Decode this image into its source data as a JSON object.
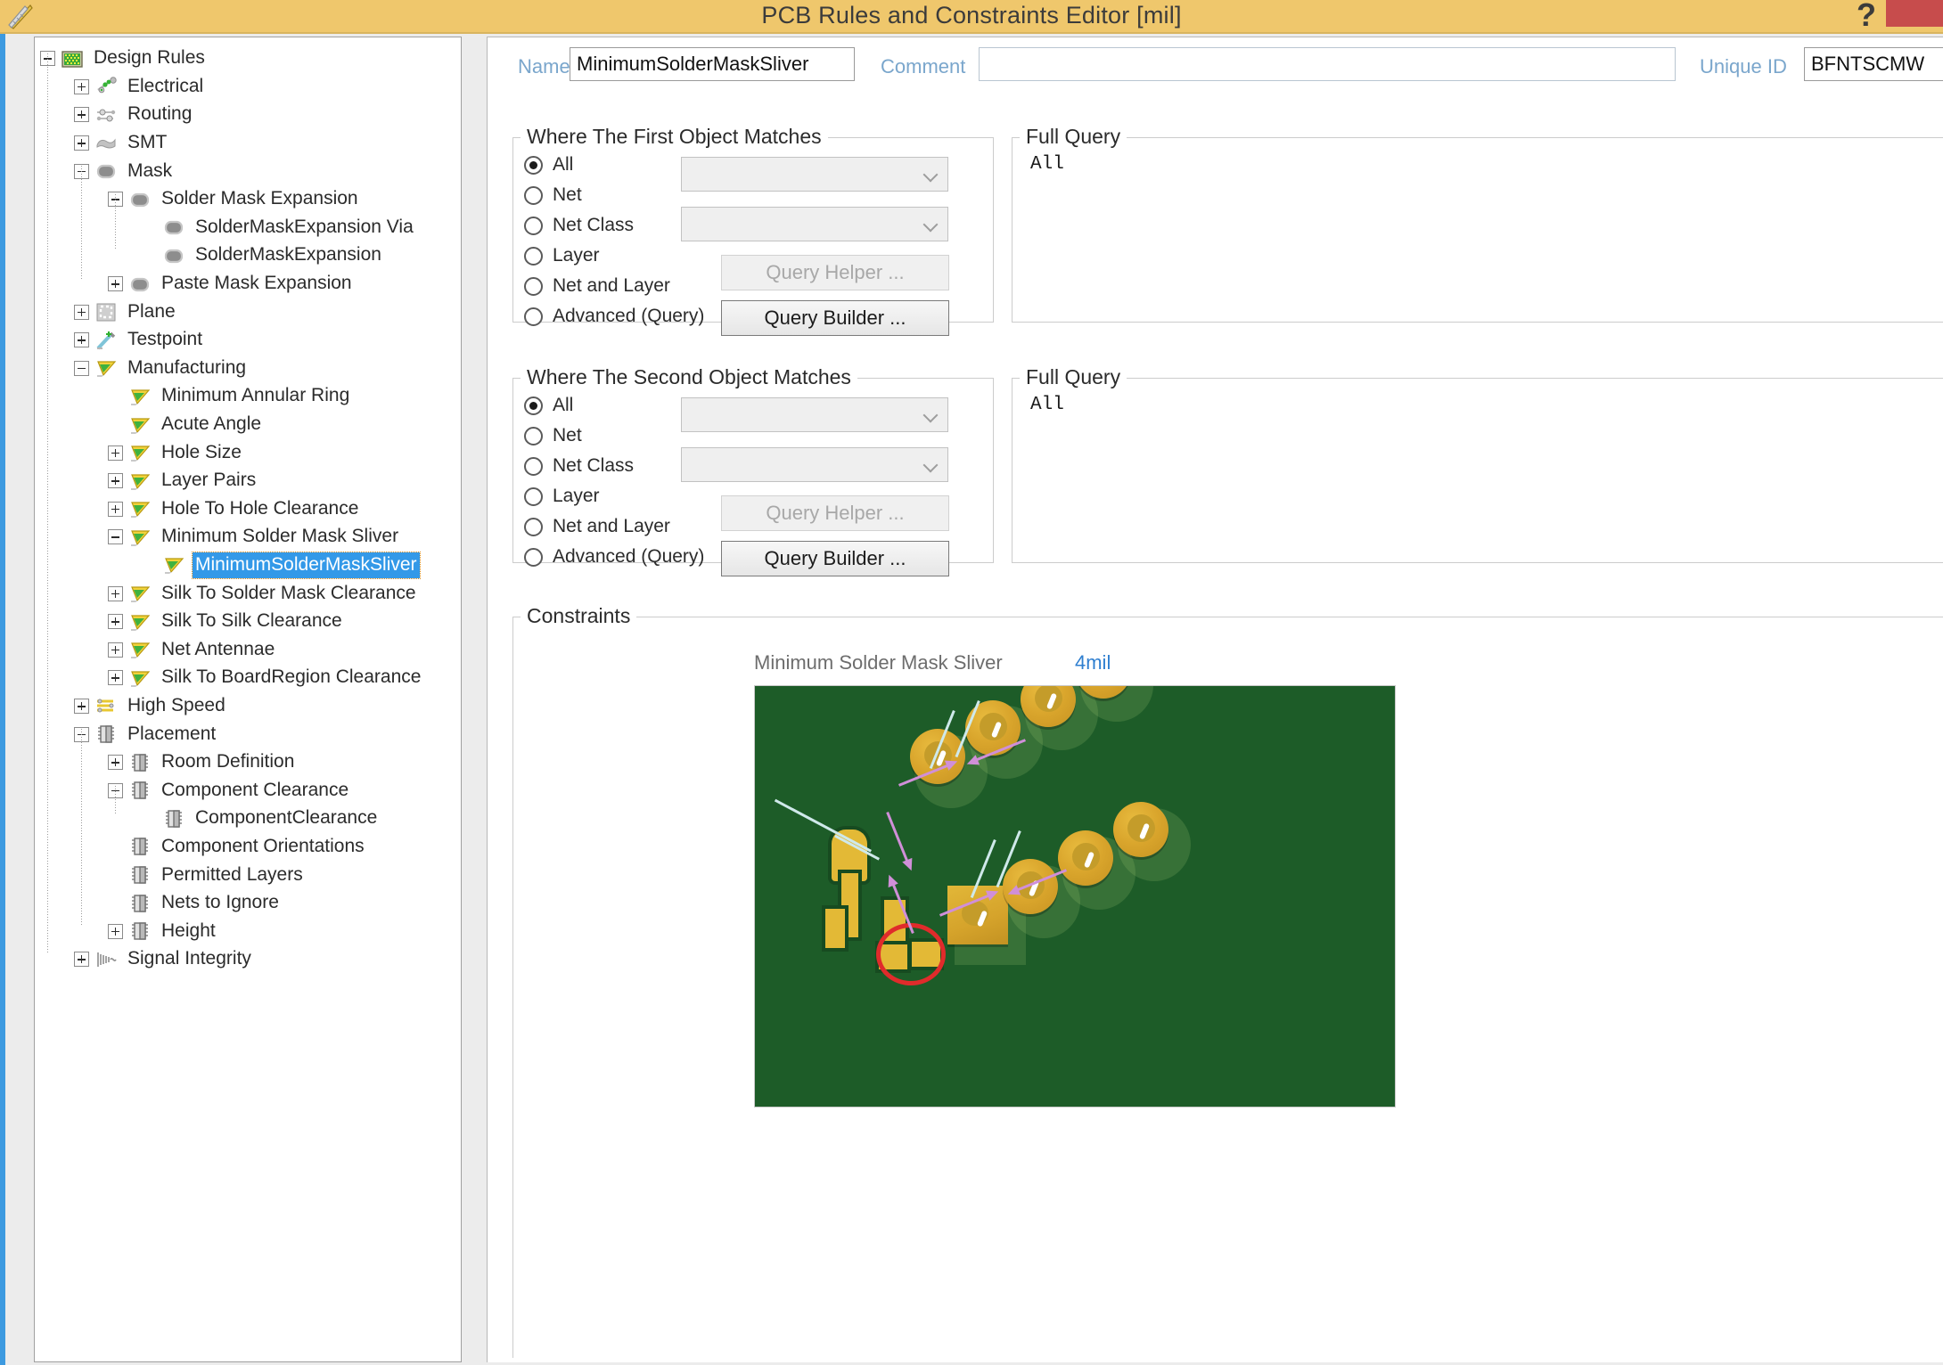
{
  "window": {
    "title": "PCB Rules and Constraints Editor [mil]",
    "help_label": "?",
    "app_icon": "ruler-triangle-icon",
    "close_label": "",
    "titlebar_color": "#efc76c",
    "accent_color": "#3d9ae0"
  },
  "tree": {
    "nodes": [
      {
        "label": "Design Rules",
        "depth": 0,
        "state": "minus",
        "icon": "design-rules-folder-icon",
        "selected": false
      },
      {
        "label": "Electrical",
        "depth": 1,
        "state": "plus",
        "icon": "electrical-icon",
        "selected": false
      },
      {
        "label": "Routing",
        "depth": 1,
        "state": "plus",
        "icon": "routing-icon",
        "selected": false
      },
      {
        "label": "SMT",
        "depth": 1,
        "state": "plus",
        "icon": "smt-icon",
        "selected": false
      },
      {
        "label": "Mask",
        "depth": 1,
        "state": "minus",
        "icon": "mask-icon",
        "selected": false
      },
      {
        "label": "Solder Mask Expansion",
        "depth": 2,
        "state": "minus",
        "icon": "mask-icon",
        "selected": false
      },
      {
        "label": "SolderMaskExpansion Via",
        "depth": 3,
        "state": "leaf",
        "icon": "mask-icon",
        "selected": false
      },
      {
        "label": "SolderMaskExpansion",
        "depth": 3,
        "state": "leaf",
        "icon": "mask-icon",
        "selected": false
      },
      {
        "label": "Paste Mask Expansion",
        "depth": 2,
        "state": "plus",
        "icon": "mask-icon",
        "selected": false
      },
      {
        "label": "Plane",
        "depth": 1,
        "state": "plus",
        "icon": "plane-icon",
        "selected": false
      },
      {
        "label": "Testpoint",
        "depth": 1,
        "state": "plus",
        "icon": "testpoint-icon",
        "selected": false
      },
      {
        "label": "Manufacturing",
        "depth": 1,
        "state": "minus",
        "icon": "manufacturing-icon",
        "selected": false
      },
      {
        "label": "Minimum Annular Ring",
        "depth": 2,
        "state": "leaf",
        "icon": "manufacturing-icon",
        "selected": false
      },
      {
        "label": "Acute Angle",
        "depth": 2,
        "state": "leaf",
        "icon": "manufacturing-icon",
        "selected": false
      },
      {
        "label": "Hole Size",
        "depth": 2,
        "state": "plus",
        "icon": "manufacturing-icon",
        "selected": false
      },
      {
        "label": "Layer Pairs",
        "depth": 2,
        "state": "plus",
        "icon": "manufacturing-icon",
        "selected": false
      },
      {
        "label": "Hole To Hole Clearance",
        "depth": 2,
        "state": "plus",
        "icon": "manufacturing-icon",
        "selected": false
      },
      {
        "label": "Minimum Solder Mask Sliver",
        "depth": 2,
        "state": "minus",
        "icon": "manufacturing-icon",
        "selected": false
      },
      {
        "label": "MinimumSolderMaskSliver",
        "depth": 3,
        "state": "leaf",
        "icon": "manufacturing-icon",
        "selected": true
      },
      {
        "label": "Silk To Solder Mask Clearance",
        "depth": 2,
        "state": "plus",
        "icon": "manufacturing-icon",
        "selected": false
      },
      {
        "label": "Silk To Silk Clearance",
        "depth": 2,
        "state": "plus",
        "icon": "manufacturing-icon",
        "selected": false
      },
      {
        "label": "Net Antennae",
        "depth": 2,
        "state": "plus",
        "icon": "manufacturing-icon",
        "selected": false
      },
      {
        "label": "Silk To BoardRegion Clearance",
        "depth": 2,
        "state": "plus",
        "icon": "manufacturing-icon",
        "selected": false
      },
      {
        "label": "High Speed",
        "depth": 1,
        "state": "plus",
        "icon": "high-speed-icon",
        "selected": false
      },
      {
        "label": "Placement",
        "depth": 1,
        "state": "minus",
        "icon": "placement-icon",
        "selected": false
      },
      {
        "label": "Room Definition",
        "depth": 2,
        "state": "plus",
        "icon": "placement-icon",
        "selected": false
      },
      {
        "label": "Component Clearance",
        "depth": 2,
        "state": "minus",
        "icon": "placement-icon",
        "selected": false
      },
      {
        "label": "ComponentClearance",
        "depth": 3,
        "state": "leaf",
        "icon": "placement-icon",
        "selected": false
      },
      {
        "label": "Component Orientations",
        "depth": 2,
        "state": "leaf",
        "icon": "placement-icon",
        "selected": false
      },
      {
        "label": "Permitted Layers",
        "depth": 2,
        "state": "leaf",
        "icon": "placement-icon",
        "selected": false
      },
      {
        "label": "Nets to Ignore",
        "depth": 2,
        "state": "leaf",
        "icon": "placement-icon",
        "selected": false
      },
      {
        "label": "Height",
        "depth": 2,
        "state": "plus",
        "icon": "placement-icon",
        "selected": false
      },
      {
        "label": "Signal Integrity",
        "depth": 1,
        "state": "plus",
        "icon": "signal-integrity-icon",
        "selected": false
      }
    ]
  },
  "header": {
    "name_label": "Name",
    "name_value": "MinimumSolderMaskSliver",
    "comment_label": "Comment",
    "comment_value": "",
    "comment_placeholder": "",
    "unique_id_label": "Unique ID",
    "unique_id_value": "BFNTSCMW"
  },
  "first_object": {
    "title": "Where The First Object Matches",
    "options": [
      "All",
      "Net",
      "Net Class",
      "Layer",
      "Net and Layer",
      "Advanced (Query)"
    ],
    "selected": "All",
    "net_combo_value": "",
    "netclass_combo_value": "",
    "query_helper_label": "Query Helper ...",
    "query_builder_label": "Query Builder ...",
    "full_query_title": "Full Query",
    "full_query_text": "All"
  },
  "second_object": {
    "title": "Where The Second Object Matches",
    "options": [
      "All",
      "Net",
      "Net Class",
      "Layer",
      "Net and Layer",
      "Advanced (Query)"
    ],
    "selected": "All",
    "net_combo_value": "",
    "netclass_combo_value": "",
    "query_helper_label": "Query Helper ...",
    "query_builder_label": "Query Builder ...",
    "full_query_title": "Full Query",
    "full_query_text": "All"
  },
  "constraints": {
    "title": "Constraints",
    "rule_label": "Minimum Solder Mask Sliver",
    "rule_value": "4mil",
    "value_color": "#2f7fd0",
    "figure": {
      "name": "pcb-solder-mask-sliver-illustration",
      "board_color": "#1d5c28",
      "pad_color": "#e3b936",
      "dimension_line_color": "#cfe9ea",
      "arrow_color": "#d08fd8",
      "violation_marker_color": "#e02b2b"
    }
  }
}
